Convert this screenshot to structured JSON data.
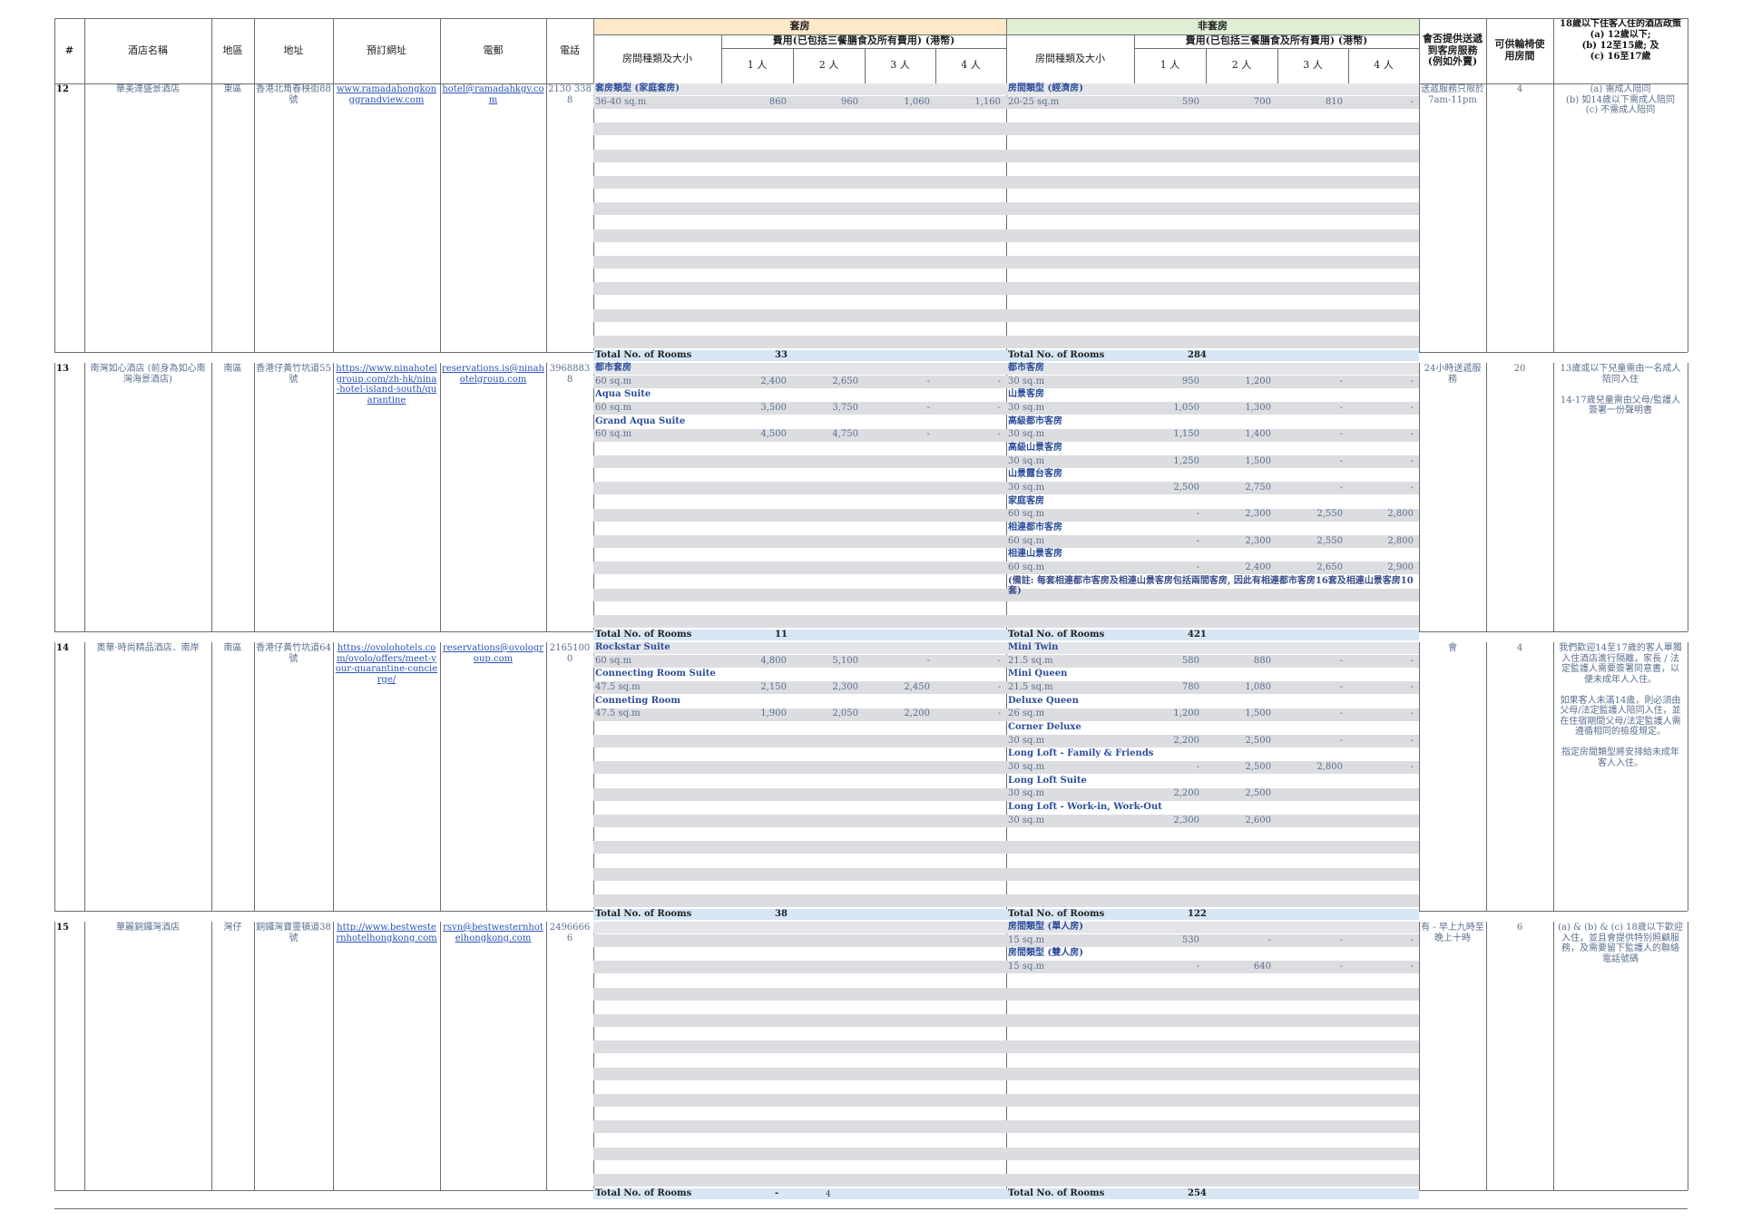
{
  "header": {
    "col_no": "#",
    "col_name": "酒店名稱",
    "col_district": "地區",
    "col_address": "地址",
    "col_url": "預訂網址",
    "col_email": "電郵",
    "col_phone": "電話",
    "suite": "套房",
    "non_suite": "非套房",
    "fee": "費用(已包括三餐膳食及所有費用) (港幣)",
    "room_type": "房間種類及大小",
    "p1": "1 人",
    "p2": "2 人",
    "p3": "3 人",
    "p4": "4 人",
    "delivery": "會否提供送遞到客房服務(例如外賣)",
    "wheelchair": "可供輪椅使用房間",
    "minor_policy": "18歲以下住客人住的酒店政策",
    "minor_a": "(a) 12歲以下;",
    "minor_b": "(b) 12至15歲; 及",
    "minor_c": "(c) 16至17歲"
  },
  "total_label": "Total No. of Rooms",
  "hotels": [
    {
      "no": "12",
      "name": "華美達盛景酒店",
      "district": "東區",
      "address": "香港北角春秧街88號",
      "url": "www.ramadahongkonggrandview.com",
      "email": "hotel@ramadahkgv.com",
      "phone": "2130 3388",
      "suite_rooms": [
        {
          "name": "套房類型 (家庭套房)",
          "size": "36-40 sq.m",
          "p1": "860",
          "p2": "960",
          "p3": "1,060",
          "p4": "1,160"
        }
      ],
      "suite_total": "33",
      "non_rooms": [
        {
          "name": "房間類型 (經濟房)",
          "size": "20-25 sq.m",
          "p1": "590",
          "p2": "700",
          "p3": "810",
          "p4": "-"
        }
      ],
      "non_note": "",
      "non_total": "284",
      "delivery": "送遞服務只限於 7am-11pm",
      "wheelchair": "4",
      "policy": "(a) 需成人陪同\n(b) 如14歲以下需成人陪同\n(c) 不需成人陪同"
    },
    {
      "no": "13",
      "name": "南灣如心酒店 (前身為如心南灣海景酒店)",
      "district": "南區",
      "address": "香港仔黃竹坑道55號",
      "url": "https://www.ninahotelgroup.com/zh-hk/nina-hotel-island-south/quarantine",
      "email": "reservations.is@ninahotelgroup.com",
      "phone": "39688838",
      "suite_rooms": [
        {
          "name": "都市套房",
          "size": "60 sq.m",
          "p1": "2,400",
          "p2": "2,650",
          "p3": "-",
          "p4": "-"
        },
        {
          "name": "Aqua Suite",
          "size": "60 sq.m",
          "p1": "3,500",
          "p2": "3,750",
          "p3": "-",
          "p4": "-"
        },
        {
          "name": "Grand Aqua Suite",
          "size": "60 sq.m",
          "p1": "4,500",
          "p2": "4,750",
          "p3": "-",
          "p4": "-"
        }
      ],
      "suite_total": "11",
      "non_rooms": [
        {
          "name": "都市客房",
          "size": "30 sq.m",
          "p1": "950",
          "p2": "1,200",
          "p3": "-",
          "p4": "-"
        },
        {
          "name": "山景客房",
          "size": "30 sq.m",
          "p1": "1,050",
          "p2": "1,300",
          "p3": "-",
          "p4": "-"
        },
        {
          "name": "高級都市客房",
          "size": "30 sq.m",
          "p1": "1,150",
          "p2": "1,400",
          "p3": "-",
          "p4": "-"
        },
        {
          "name": "高級山景客房",
          "size": "30 sq.m",
          "p1": "1,250",
          "p2": "1,500",
          "p3": "-",
          "p4": "-"
        },
        {
          "name": "山景露台客房",
          "size": "30 sq.m",
          "p1": "2,500",
          "p2": "2,750",
          "p3": "-",
          "p4": "-"
        },
        {
          "name": "家庭客房",
          "size": "60 sq.m",
          "p1": "-",
          "p2": "2,300",
          "p3": "2,550",
          "p4": "2,800"
        },
        {
          "name": "相連都市客房",
          "size": "60 sq.m",
          "p1": "-",
          "p2": "2,300",
          "p3": "2,550",
          "p4": "2,800"
        },
        {
          "name": "相連山景客房",
          "size": "60 sq.m",
          "p1": "-",
          "p2": "2,400",
          "p3": "2,650",
          "p4": "2,900"
        }
      ],
      "non_note": "(備註: 每套相連都市客房及相連山景客房包括兩間客房, 因此有相連都市客房16套及相連山景客房10套)",
      "non_total": "421",
      "delivery": "24小時送遞服務",
      "wheelchair": "20",
      "policy": "13歲或以下兒童需由一名成人陪同入住\n\n14-17歲兒童需由父母/監護人簽署一份聲明書"
    },
    {
      "no": "14",
      "name": "奧華·時尚精品酒店．南岸",
      "district": "南區",
      "address": "香港仔黃竹坑道64號",
      "url": "https://ovolohotels.com/ovolo/offers/meet-your-quarantine-concierge/",
      "email": "reservations@ovologroup.com",
      "phone": "21651000",
      "suite_rooms": [
        {
          "name": "Rockstar Suite",
          "size": "60 sq.m",
          "p1": "4,800",
          "p2": "5,100",
          "p3": "-",
          "p4": "-"
        },
        {
          "name": "Connecting Room Suite",
          "size": "47.5 sq.m",
          "p1": "2,150",
          "p2": "2,300",
          "p3": "2,450",
          "p4": "-"
        },
        {
          "name": "Conneting Room",
          "size": "47.5 sq.m",
          "p1": "1,900",
          "p2": "2,050",
          "p3": "2,200",
          "p4": "-"
        }
      ],
      "suite_total": "38",
      "non_rooms": [
        {
          "name": "Mini Twin",
          "size": "21.5 sq.m",
          "p1": "580",
          "p2": "880",
          "p3": "-",
          "p4": "-"
        },
        {
          "name": "Mini Queen",
          "size": "21.5 sq.m",
          "p1": "780",
          "p2": "1,080",
          "p3": "-",
          "p4": "-"
        },
        {
          "name": "Deluxe Queen",
          "size": "26 sq.m",
          "p1": "1,200",
          "p2": "1,500",
          "p3": "-",
          "p4": "-"
        },
        {
          "name": "Corner Deluxe",
          "size": "30 sq.m",
          "p1": "2,200",
          "p2": "2,500",
          "p3": "-",
          "p4": "-"
        },
        {
          "name": "Long Loft - Family & Friends",
          "size": "30 sq.m",
          "p1": "-",
          "p2": "2,500",
          "p3": "2,800",
          "p4": "-"
        },
        {
          "name": "Long Loft Suite",
          "size": "30 sq.m",
          "p1": "2,200",
          "p2": "2,500",
          "p3": "",
          "p4": ""
        },
        {
          "name": "Long Loft - Work-in, Work-Out",
          "size": "30 sq.m",
          "p1": "2,300",
          "p2": "2,600",
          "p3": "",
          "p4": ""
        }
      ],
      "non_note": "",
      "non_total": "122",
      "delivery": "會",
      "wheelchair": "4",
      "policy": "我們歡迎14至17歲的客人單獨入住酒店進行隔離，家長 / 法定監護人需要簽署同意書，以便未成年人入住。\n\n如果客人未滿14歲，則必須由父母/法定監護人陪同入住，並在住宿期間父母/法定監護人需遵循相同的檢疫規定。\n\n指定房間類型將安排給未成年客人入住。"
    },
    {
      "no": "15",
      "name": "華麗銅鑼灣酒店",
      "district": "灣仔",
      "address": "銅鑼灣寶靈頓道38號",
      "url": "http://www.bestwesternhotelhongkong.com",
      "email": "rsvn@bestwesternhotelhongkong.com",
      "phone": "24966666",
      "suite_rooms": [],
      "suite_total": "-",
      "non_rooms": [
        {
          "name": "房間類型 (單人房)",
          "size": "15 sq.m",
          "p1": "530",
          "p2": "-",
          "p3": "-",
          "p4": "-"
        },
        {
          "name": "房間類型 (雙人房)",
          "size": "15 sq.m",
          "p1": "-",
          "p2": "640",
          "p3": "-",
          "p4": "-"
        }
      ],
      "non_note": "",
      "non_total": "254",
      "delivery": "有 - 早上九時至晚上十時",
      "wheelchair": "6",
      "policy": "(a) & (b) & (c) 18歲以下歡迎入住，並且會提供特別照顧服務，及需要留下監護人的聯絡電話號碼"
    }
  ],
  "page_number": "4"
}
